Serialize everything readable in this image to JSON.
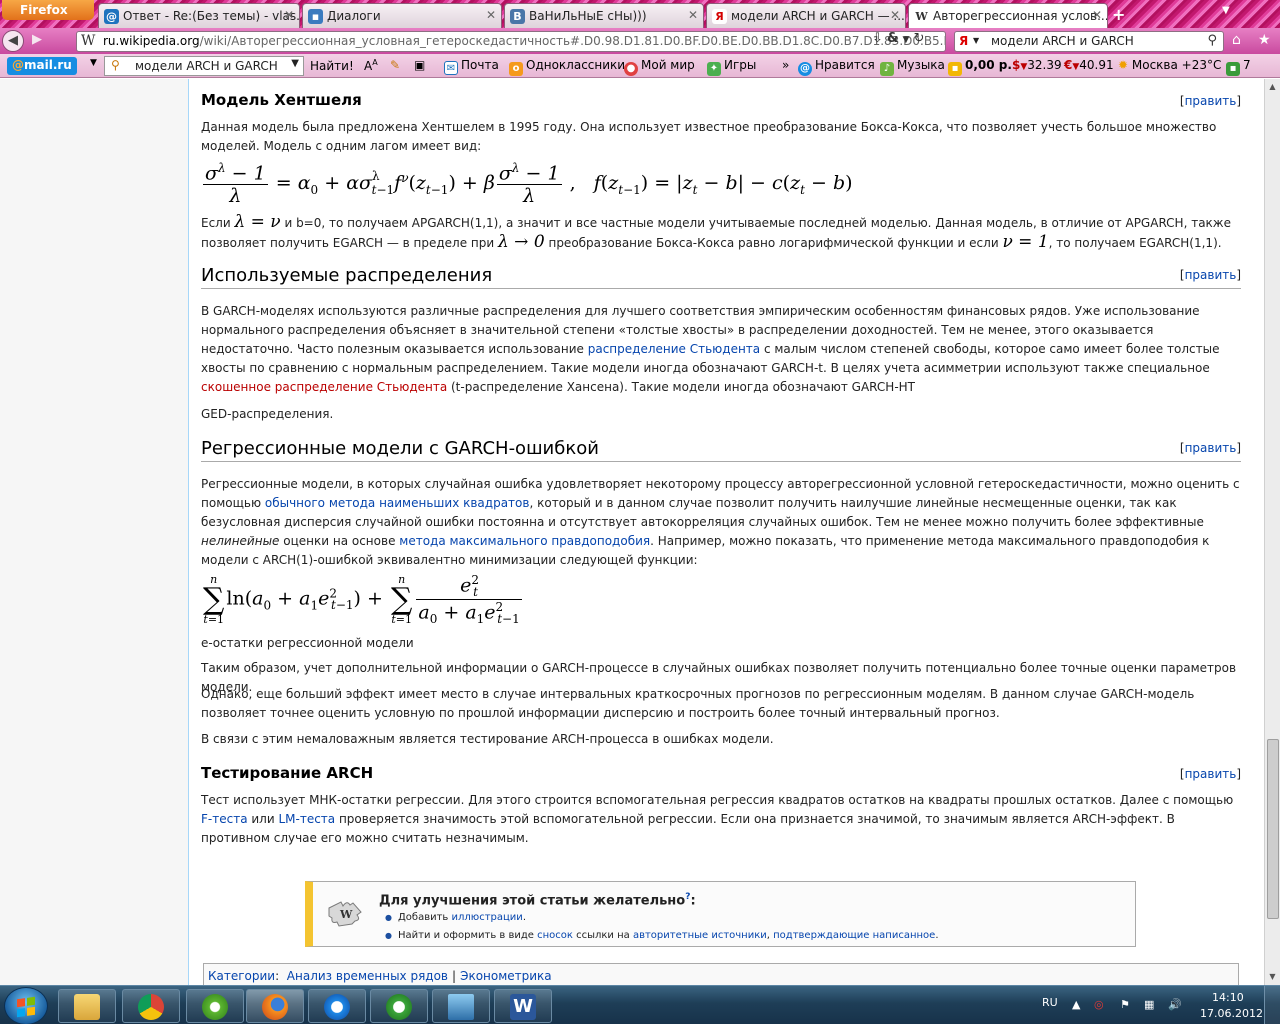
{
  "browser": {
    "menu_button": "Firefox",
    "tabs": [
      {
        "label": "Ответ - Re:(Без темы) - vlas...",
        "icon": "mail-at-icon",
        "color": "#1e73be"
      },
      {
        "label": "Диалоги",
        "icon": "chat-icon",
        "color": "#3b7bbf"
      },
      {
        "label": "ВаНиЛьНыЕ сНы)))",
        "icon": "vk-icon",
        "color": "#4a76a8"
      },
      {
        "label": "модели ARCH и GARCH — ...",
        "icon": "yandex-icon",
        "color": "#d40000"
      },
      {
        "label": "Авторегрессионная услов...",
        "icon": "wikipedia-icon",
        "color": "#333333"
      }
    ],
    "new_tab": "+",
    "url_domain": "ru.wikipedia.org",
    "url_path": "/wiki/Авторегрессионная_условная_гетероскедастичность#.D0.98.D1.81.D0.BF.D0.BE.D0.BB.D1.8C.D0.B7.D1.83.D0.B5.D0.B",
    "search_engine_icon": "Я",
    "search_value": "модели ARCH и GARCH"
  },
  "mailru": {
    "logo_at": "@",
    "logo_text": "mail.ru",
    "search_value": "модели ARCH и GARCH",
    "find_button": "Найти!",
    "items": {
      "mail": "Почта",
      "ok": "Одноклассники",
      "myworld": "Мой мир",
      "games": "Игры",
      "more": "»",
      "like": "Нравится",
      "music": "Музыка",
      "balance": "0,00 р.",
      "usd": "32.39",
      "eur": "40.91",
      "weather": "Москва +23°C",
      "count": "7"
    }
  },
  "article": {
    "edit_label": "править",
    "s1": {
      "title": "Модель Хентшеля",
      "p1": "Данная модель была предложена Хентшелем в 1995 году. Она использует известное преобразование Бокса-Кокса, что позволяет учесть большое множество моделей. Модель с одним лагом имеет вид:",
      "p2a": "Если ",
      "p2b": " и b=0, то получаем APGARCH(1,1), а значит и все частные модели учитываемые последней моделью. Данная модель, в отличие от APGARCH, также позволяет получить EGARCH — в пределе при ",
      "p2c": " преобразование Бокса-Кокса равно логарифмической функции и если ",
      "p2d": ", то получаем EGARCH(1,1)."
    },
    "s2": {
      "title": "Используемые распределения",
      "p1a": "В GARCH-моделях используются различные распределения для лучшего соответствия эмпирическим особенностям финансовых рядов. Уже использование нормального распределения объясняет в значительной степени «толстые хвосты» в распределении доходностей. Тем не менее, этого оказывается недостаточно. Часто полезным оказывается использование ",
      "link1": "распределение Стьюдента",
      "p1b": " с малым числом степеней свободы, которое само имеет более толстые хвосты по сравнению с нормальным распределением. Такие модели иногда обозначают GARCH-t. В целях учета асимметрии используют также специальное ",
      "link2": "скошенное распределение Стьюдента",
      "p1c": " (t-распределение Хансена). Такие модели иногда обозначают GARCH-HT",
      "p2": "GED-распределения."
    },
    "s3": {
      "title": "Регрессионные модели с GARCH-ошибкой",
      "p1a": "Регрессионные модели, в которых случайная ошибка удовлетворяет некоторому процессу авторегрессионной условной гетероскедастичности, можно оценить с помощью ",
      "link1": "обычного метода наименьших квадратов",
      "p1b": ", который и в данном случае позволит получить наилучшие линейные несмещенные оценки, так как безусловная дисперсия случайной ошибки постоянна и отсутствует автокорреляция случайных ошибок. Тем не менее можно получить более эффективные ",
      "italic": "нелинейные",
      "p1c": " оценки на основе ",
      "link2": "метода максимального правдоподобия",
      "p1d": ". Например, можно показать, что применение метода максимального правдоподобия к модели с ARCH(1)-ошибкой эквивалентно минимизации следующей функции:",
      "p2": "e-остатки регрессионной модели",
      "p3": "Таким образом, учет дополнительной информации о GARCH-процессе в случайных ошибках позволяет получить потенциально более точные оценки параметров модели.",
      "p4": "Однако, еще больший эффект имеет место в случае интервальных краткосрочных прогнозов по регрессионным моделям. В данном случае GARCH-модель позволяет точнее оценить условную по прошлой информации дисперсию и построить более точный интервальный прогноз.",
      "p5": "В связи с этим немаловажным является тестирование ARCH-процесса в ошибках модели."
    },
    "s4": {
      "title": "Тестирование ARCH",
      "p1a": "Тест использует МНК-остатки регрессии. Для этого строится вспомогательная регрессия квадратов остатков на квадраты прошлых остатков. Далее с помощью ",
      "link1": "F-теста",
      "p1b": " или ",
      "link2": "LM-теста",
      "p1c": " проверяется значимость этой вспомогательной регрессии. Если она признается значимой, то значимым является ARCH-эффект. В противном случае его можно считать незначимым."
    },
    "improve": {
      "title": "Для улучшения этой статьи желательно",
      "q": "?",
      "colon": ":",
      "item1a": "Добавить ",
      "item1link": "иллюстрации",
      "item1b": ".",
      "item2a": "Найти и оформить в виде ",
      "item2link1": "сносок",
      "item2b": " ссылки на ",
      "item2link2": "авторитетные источники",
      "item2c": ", ",
      "item2link3": "подтверждающие написанное",
      "item2d": "."
    },
    "categories": {
      "label": "Категории",
      "colon": ":",
      "items": [
        "Анализ временных рядов",
        "Эконометрика"
      ]
    }
  },
  "taskbar": {
    "lang": "RU",
    "time": "14:10",
    "date": "17.06.2012"
  }
}
